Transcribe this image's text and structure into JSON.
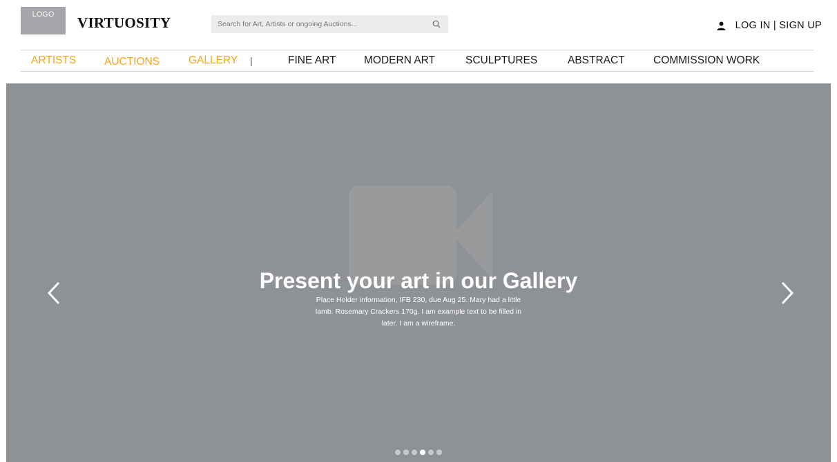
{
  "header": {
    "logo_label": "LOGO",
    "brand": "VIRTUOSITY",
    "search_placeholder": "Search for Art, Artists or ongoing Auctions...",
    "login_label": "LOG IN | SIGN UP"
  },
  "nav": {
    "primary": [
      {
        "label": "ARTISTS"
      },
      {
        "label": "AUCTIONS"
      },
      {
        "label": "GALLERY"
      }
    ],
    "separator": "|",
    "secondary": [
      {
        "label": "FINE ART"
      },
      {
        "label": "MODERN ART"
      },
      {
        "label": "SCULPTURES"
      },
      {
        "label": "ABSTRACT"
      },
      {
        "label": "COMMISSION WORK"
      }
    ],
    "primary_color": "#f7a41c",
    "secondary_color": "#1a1a1a"
  },
  "hero": {
    "title": "Present your art in our Gallery",
    "text": "Place Holder information, IFB 230, due Aug 25. Mary had a little lamb. Rosemary Crackers 170g. I am example text to be filled in later. I am a wireframe.",
    "background_color": "#8e9195",
    "media_icon": "video-camera-icon",
    "prev_icon": "chevron-left-icon",
    "next_icon": "chevron-right-icon",
    "slide_count": 6,
    "active_slide": 4
  }
}
